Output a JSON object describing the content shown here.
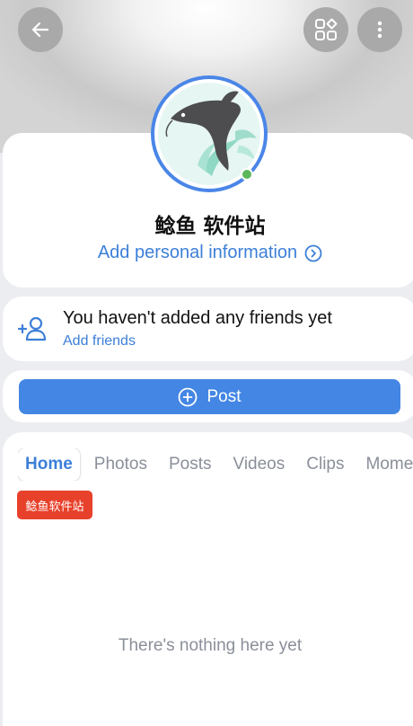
{
  "header": {
    "back_icon": "arrow-left-icon",
    "apps_icon": "apps-grid-icon",
    "more_icon": "more-vertical-icon"
  },
  "profile": {
    "name": "鲶鱼 软件站",
    "add_info_label": "Add personal information",
    "online": true,
    "accent_color": "#4a86e8"
  },
  "friends": {
    "title": "You haven't added any friends yet",
    "link_label": "Add friends"
  },
  "post": {
    "label": "Post"
  },
  "tabs": [
    {
      "label": "Home",
      "active": true
    },
    {
      "label": "Photos",
      "active": false
    },
    {
      "label": "Posts",
      "active": false
    },
    {
      "label": "Videos",
      "active": false
    },
    {
      "label": "Clips",
      "active": false
    },
    {
      "label": "Moments",
      "active": false
    }
  ],
  "tag": {
    "label": "鲶鱼软件站",
    "color": "#e8412b"
  },
  "empty_state": "There's nothing here yet"
}
